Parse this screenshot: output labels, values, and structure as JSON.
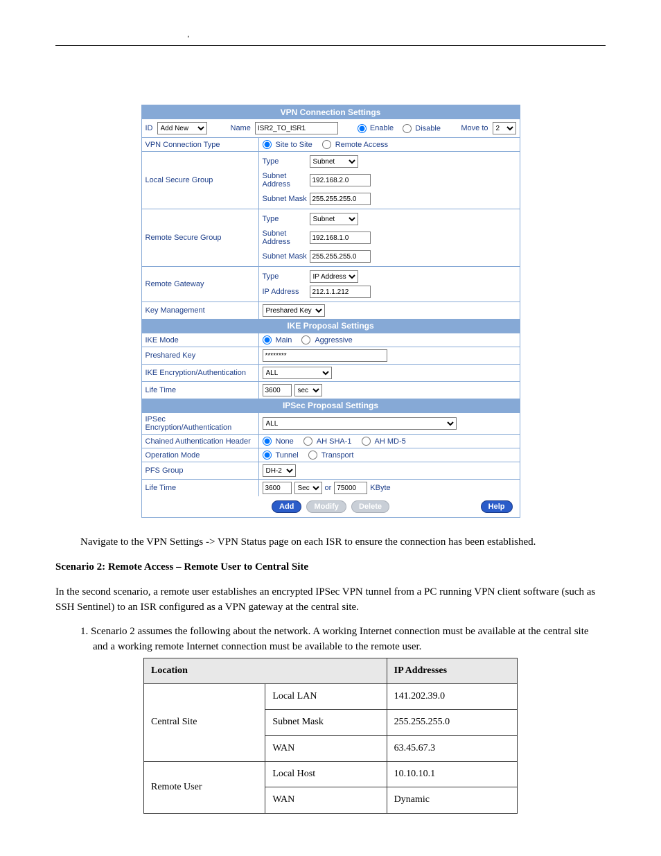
{
  "vpn": {
    "title": "VPN Connection Settings",
    "id_label": "ID",
    "id_value": "Add New",
    "name_label": "Name",
    "name_value": "ISR2_TO_ISR1",
    "enable": "Enable",
    "disable": "Disable",
    "move_to": "Move to",
    "move_value": "2",
    "conn_type_label": "VPN Connection Type",
    "site_to_site": "Site to Site",
    "remote_access": "Remote Access",
    "local_secure": "Local Secure Group",
    "remote_secure": "Remote Secure Group",
    "type_label": "Type",
    "subnet_addr_label": "Subnet\nAddress",
    "subnet_mask_label": "Subnet Mask",
    "type_subnet": "Subnet",
    "local_addr": "192.168.2.0",
    "local_mask": "255.255.255.0",
    "remote_addr": "192.168.1.0",
    "remote_mask": "255.255.255.0",
    "remote_gw_label": "Remote Gateway",
    "gw_type": "IP Address",
    "ip_addr_label": "IP Address",
    "gw_ip": "212.1.1.212",
    "key_mgmt_label": "Key Management",
    "key_mgmt_value": "Preshared Key"
  },
  "ike": {
    "title": "IKE Proposal Settings",
    "mode_label": "IKE Mode",
    "main": "Main",
    "aggressive": "Aggressive",
    "psk_label": "Preshared Key",
    "psk_value": "********",
    "enc_label": "IKE Encryption/Authentication",
    "enc_value": "ALL",
    "life_label": "Life Time",
    "life_value": "3600",
    "life_unit": "sec"
  },
  "ipsec": {
    "title": "IPSec Proposal Settings",
    "enc_label": "IPSec\nEncryption/Authentication",
    "enc_value": "ALL",
    "ah_label": "Chained Authentication Header",
    "none": "None",
    "sha": "AH SHA-1",
    "md5": "AH MD-5",
    "op_label": "Operation Mode",
    "tunnel": "Tunnel",
    "transport": "Transport",
    "pfs_label": "PFS Group",
    "pfs_value": "DH-2",
    "life_label": "Life Time",
    "life_sec": "3600",
    "life_sec_unit": "Sec",
    "or": "or",
    "life_kb": "75000",
    "kbyte": "KByte"
  },
  "buttons": {
    "add": "Add",
    "modify": "Modify",
    "delete": "Delete",
    "help": "Help"
  },
  "text": {
    "p1": "Navigate to the VPN Settings -> VPN Status page on each ISR to ensure the connection has been established.",
    "s2_title": "Scenario 2: Remote Access – Remote User to Central Site",
    "s2_p1": "In the second scenario, a remote user establishes an encrypted IPSec VPN tunnel from a PC running VPN client software (such as SSH Sentinel) to an ISR configured as a VPN gateway at the central site.",
    "s2_step1": "1.  Scenario 2 assumes the following about the network. A working Internet connection must be available at the central site and a working remote Internet connection must be available to the remote user.",
    "t_h1": "Location",
    "t_h2": "",
    "t_h3": "IP Addresses",
    "t_r1c1": "Central Site",
    "t_r1c2": "Local LAN",
    "t_r1c3": "141.202.39.0",
    "t_r2c2": "Subnet Mask",
    "t_r2c3": "255.255.255.0",
    "t_r3c2": "WAN",
    "t_r3c3": "63.45.67.3",
    "t_r4c1": "Remote User",
    "t_r4c2": "Local Host",
    "t_r4c3": "10.10.10.1",
    "t_r5c2": "WAN",
    "t_r5c3": "Dynamic"
  }
}
